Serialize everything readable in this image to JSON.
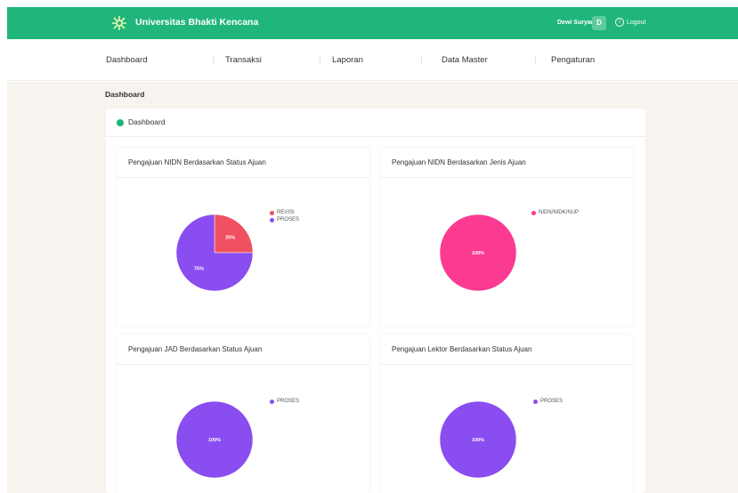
{
  "header": {
    "brand": "Universitas Bhakti Kencana",
    "user_name": "Dewi Suryani",
    "avatar_letter": "D",
    "logout_label": "Logout",
    "accent": "#1fb57b"
  },
  "nav": {
    "items": [
      {
        "label": "Dashboard"
      },
      {
        "label": "Transaksi"
      },
      {
        "label": "Laporan"
      },
      {
        "label": "Data Master"
      },
      {
        "label": "Pengaturan"
      }
    ]
  },
  "breadcrumb": "Dashboard",
  "card": {
    "title": "Dashboard",
    "icon": "dashboard-icon"
  },
  "chart_data": [
    {
      "type": "pie",
      "title": "Pengajuan NIDN Berdasarkan Status Ajuan",
      "categories": [
        "REVISI",
        "PROSES"
      ],
      "values": [
        25,
        75
      ],
      "labels": [
        "25%",
        "75%"
      ],
      "colors": [
        "#f0505f",
        "#8a4df0"
      ],
      "legend_position": "top-right"
    },
    {
      "type": "pie",
      "title": "Pengajuan NIDN Berdasarkan Jenis Ajuan",
      "categories": [
        "NIDN/NIDK/NUP"
      ],
      "values": [
        100
      ],
      "labels": [
        "100%"
      ],
      "colors": [
        "#fb3a92"
      ],
      "legend_position": "top-right"
    },
    {
      "type": "pie",
      "title": "Pengajuan JAD Berdasarkan Status Ajuan",
      "categories": [
        "PROSES"
      ],
      "values": [
        100
      ],
      "labels": [
        "100%"
      ],
      "colors": [
        "#8a4df0"
      ],
      "legend_position": "top-right"
    },
    {
      "type": "pie",
      "title": "Pengajuan Lektor Berdasarkan Status Ajuan",
      "categories": [
        "PROSES"
      ],
      "values": [
        100
      ],
      "labels": [
        "100%"
      ],
      "colors": [
        "#8a4df0"
      ],
      "legend_position": "top-right"
    }
  ]
}
